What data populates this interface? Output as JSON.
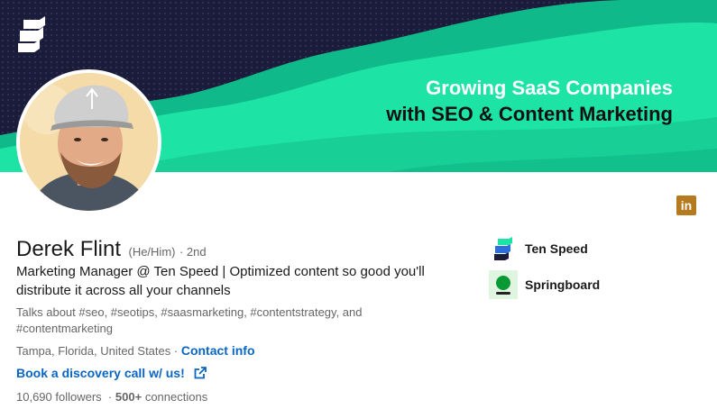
{
  "banner": {
    "line1": "Growing SaaS Companies",
    "line2": "with SEO & Content Marketing",
    "colors": {
      "dark": "#1b1c3a",
      "teal": "#1de3a4"
    }
  },
  "profile": {
    "name": "Derek Flint",
    "pronouns": "(He/Him)",
    "degree": "· 2nd",
    "headline": "Marketing Manager @ Ten Speed | Optimized content so good you'll distribute it across all your channels",
    "talks_about": "Talks about #seo, #seotips, #saasmarketing, #contentstrategy, and #contentmarketing",
    "location": "Tampa, Florida, United States",
    "separator": "·",
    "contact_label": "Contact info",
    "cta_label": "Book a discovery call w/ us!",
    "followers": "10,690",
    "followers_label": "followers",
    "connections": "500+",
    "connections_label": "connections",
    "stats_separator": "·"
  },
  "badge": {
    "label": "in",
    "icon": "linkedin-icon"
  },
  "orgs": [
    {
      "name": "Ten Speed",
      "icon": "ten-speed-logo"
    },
    {
      "name": "Springboard",
      "icon": "springboard-logo"
    }
  ]
}
